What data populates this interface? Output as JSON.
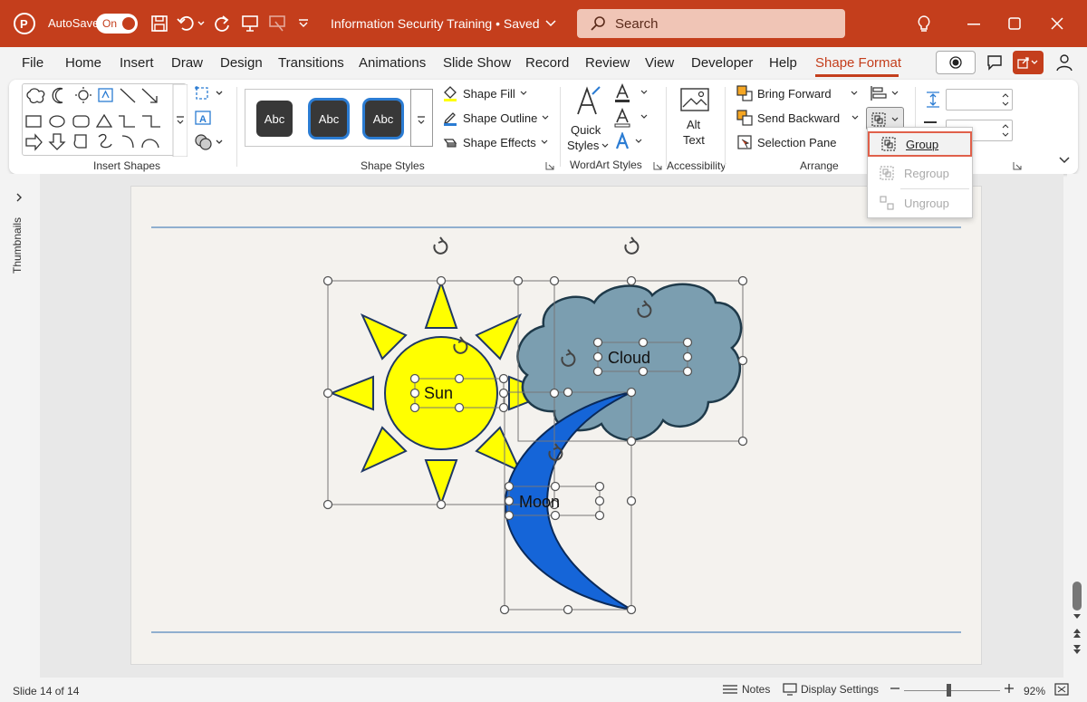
{
  "titlebar": {
    "autosave_label": "AutoSave",
    "autosave_state": "On",
    "doc_title": "Information Security Training • Saved",
    "search_placeholder": "Search"
  },
  "menu": {
    "items": [
      "File",
      "Home",
      "Insert",
      "Draw",
      "Design",
      "Transitions",
      "Animations",
      "Slide Show",
      "Record",
      "Review",
      "View",
      "Developer",
      "Help",
      "Shape Format"
    ],
    "active": "Shape Format"
  },
  "ribbon": {
    "insert_shapes_label": "Insert Shapes",
    "shape_styles_label": "Shape Styles",
    "style_sample": "Abc",
    "shape_fill": "Shape Fill",
    "shape_outline": "Shape Outline",
    "shape_effects": "Shape Effects",
    "quick_styles": "Quick Styles",
    "quick_styles_line1": "Quick",
    "quick_styles_line2": "Styles",
    "wordart_label": "WordArt Styles",
    "alt_text_line1": "Alt",
    "alt_text_line2": "Text",
    "accessibility_label": "Accessibility",
    "bring_forward": "Bring Forward",
    "send_backward": "Send Backward",
    "selection_pane": "Selection Pane",
    "arrange_label": "Arrange"
  },
  "group_menu": {
    "group": "Group",
    "regroup": "Regroup",
    "ungroup": "Ungroup"
  },
  "thumbnails_label": "Thumbnails",
  "slide": {
    "sun_label": "Sun",
    "cloud_label": "Cloud",
    "moon_label": "Moon"
  },
  "status": {
    "slide_counter": "Slide 14 of 14",
    "notes": "Notes",
    "display_settings": "Display Settings",
    "zoom": "92%"
  },
  "colors": {
    "accent": "#c43e1c",
    "sun_fill": "#ffff00",
    "cloud_fill": "#7b9eb0",
    "moon_fill": "#1565d8"
  }
}
